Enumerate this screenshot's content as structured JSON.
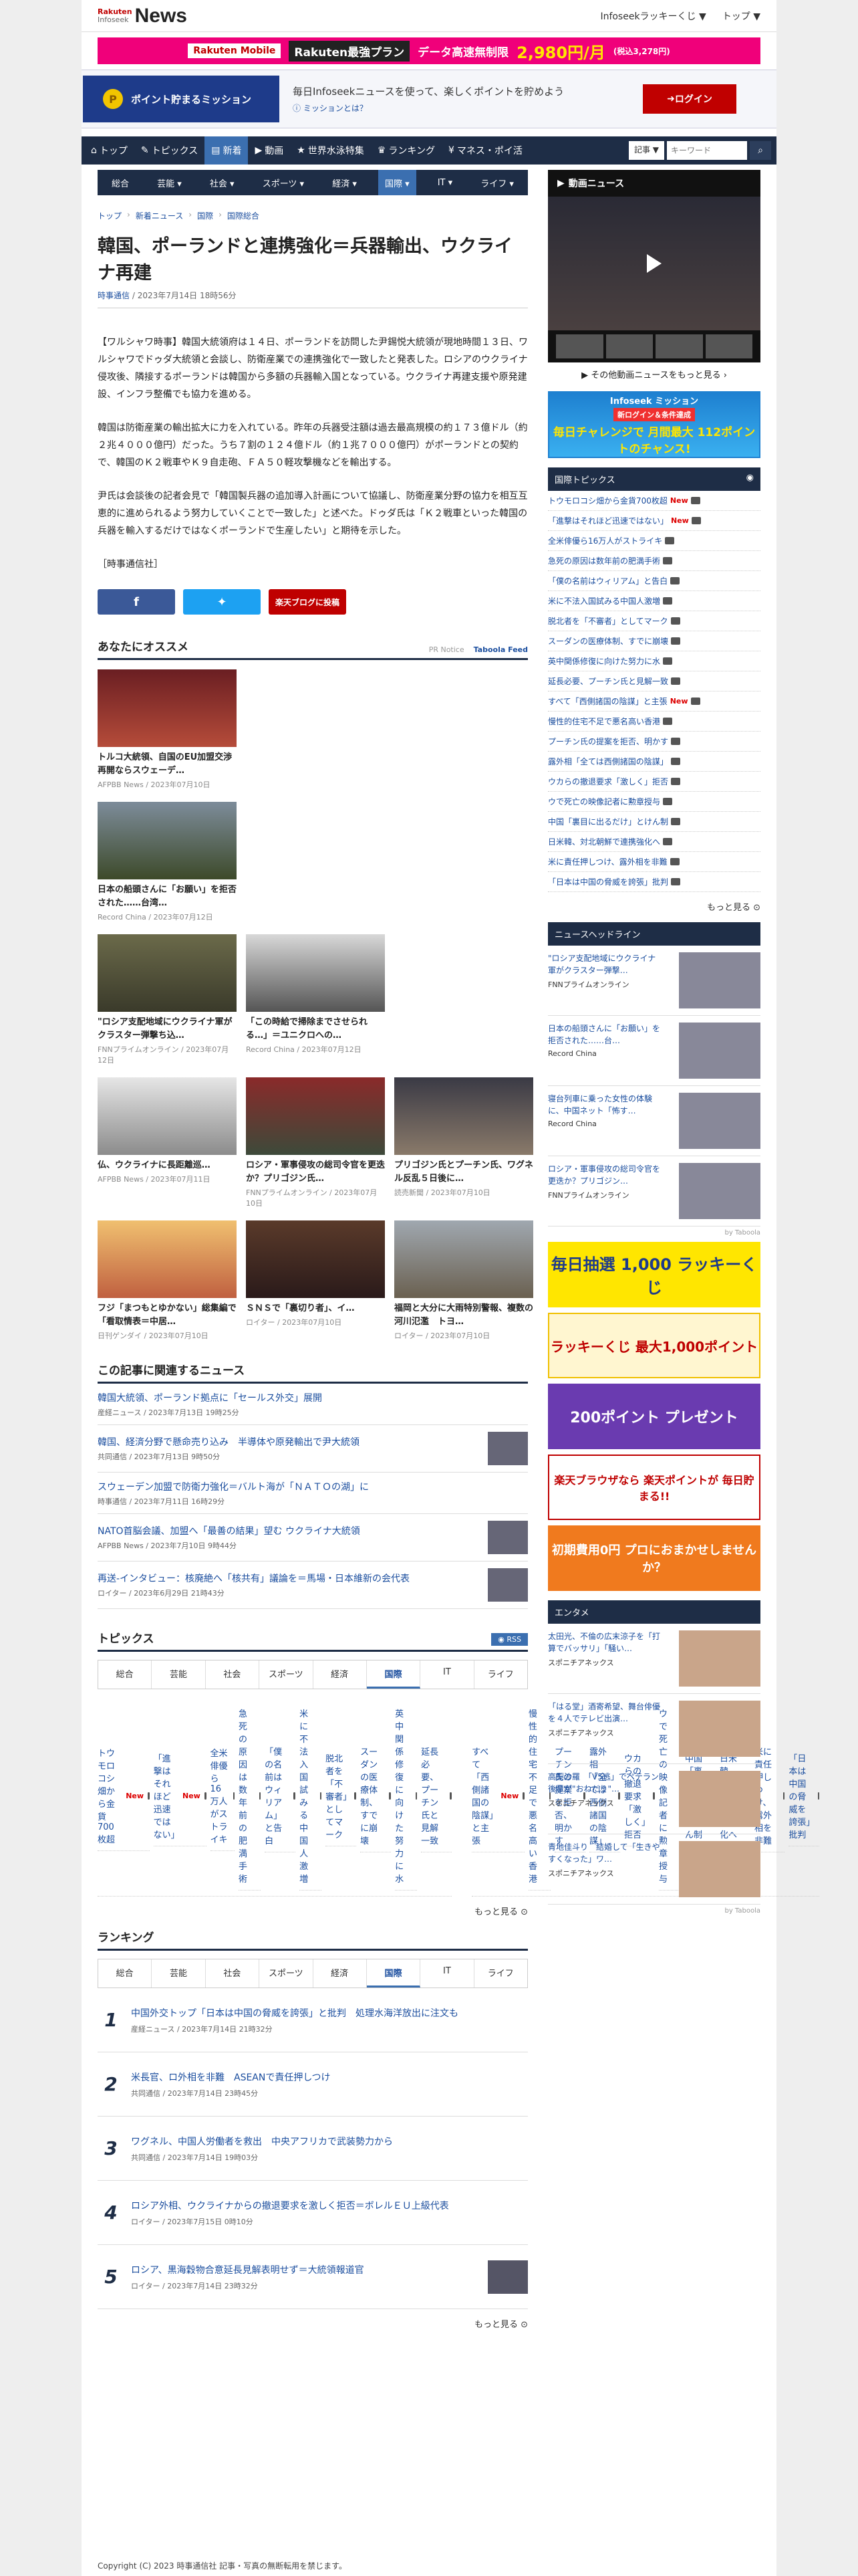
{
  "header": {
    "brand_top": "Rakuten",
    "brand_sub": "Infoseek",
    "brand_news": "News",
    "links": [
      "Infoseekラッキーくじ ▼",
      "トップ ▼"
    ]
  },
  "banner": {
    "b1": "Rakuten Mobile",
    "b2": "Rakuten最強プラン",
    "b3": "データ高速無制限",
    "price": "2,980円/月",
    "price_small": "(税込3,278円)"
  },
  "mission": {
    "title": "ポイント貯まるミッション",
    "text": "毎日Infoseekニュースを使って、楽しくポイントを貯めよう",
    "link": "ミッションとは？",
    "login": "ログイン"
  },
  "nav": {
    "items": [
      "トップ",
      "トピックス",
      "新着",
      "動画",
      "世界水泳特集",
      "ランキング",
      "マネス・ポイ活"
    ],
    "search_select": "記事 ▼",
    "search_placeholder": "キーワード"
  },
  "subnav": [
    "総合",
    "芸能 ▾",
    "社会 ▾",
    "スポーツ ▾",
    "経済 ▾",
    "国際 ▾",
    "IT ▾",
    "ライフ ▾"
  ],
  "breadcrumb": [
    "トップ",
    "新着ニュース",
    "国際",
    "国際総合"
  ],
  "article": {
    "title": "韓国、ポーランドと連携強化＝兵器輸出、ウクライナ再建",
    "source": "時事通信",
    "date": " / 2023年7月14日 18時56分",
    "p1": "【ワルシャワ時事】韓国大統領府は１４日、ポーランドを訪問した尹錫悦大統領が現地時間１３日、ワルシャワでドゥダ大統領と会談し、防衛産業での連携強化で一致したと発表した。ロシアのウクライナ侵攻後、隣接するポーランドは韓国から多額の兵器輸入国となっている。ウクライナ再建支援や原発建設、インフラ整備でも協力を進める。",
    "p2": "韓国は防衛産業の輸出拡大に力を入れている。昨年の兵器受注額は過去最高規模の約１７３億ドル（約２兆４０００億円）だった。うち７割の１２４億ドル（約１兆７０００億円）がポーランドとの契約で、韓国のＫ２戦車やＫ９自走砲、ＦＡ５０軽攻撃機などを輸出する。",
    "p3": "尹氏は会談後の記者会見で「韓国製兵器の追加導入計画について協議し、防衛産業分野の協力を相互互恵的に進められるよう努力していくことで一致した」と述べた。ドゥダ氏は「Ｋ２戦車といった韓国の兵器を輸入するだけではなくポーランドで生産したい」と期待を示した。",
    "p4": "［時事通信社］"
  },
  "share": {
    "rakuten": "楽天ブログに投稿",
    "jiji": "JIJI PRESS",
    "jiji_sub": "時事通信社"
  },
  "recommend": {
    "title": "あなたにオススメ",
    "credit": "PR Notice",
    "provider": "Taboola Feed",
    "items": [
      {
        "title": "トルコ大統領、自国のEU加盟交渉再開ならスウェーデ…",
        "src": "AFPBB News / 2023年07月10日"
      },
      {
        "title": "日本の船頭さんに「お願い」を拒否された……台湾…",
        "src": "Record China / 2023年07月12日"
      },
      {
        "title": "\"ロシア支配地域にウクライナ軍がクラスター弾撃ち込…",
        "src": "FNNプライムオンライン / 2023年07月12日"
      },
      {
        "title": "「この時給で掃除までさせられる…」＝ユニクロへの…",
        "src": "Record China / 2023年07月12日"
      },
      {
        "title": "仏、ウクライナに長距離巡…",
        "src": "AFPBB News / 2023年07月11日"
      },
      {
        "title": "ロシア・軍事侵攻の総司令官を更迭か？プリゴジン氏…",
        "src": "FNNプライムオンライン / 2023年07月10日"
      },
      {
        "title": "プリゴジン氏とプーチン氏、ワグネル反乱５日後に…",
        "src": "読売新聞 / 2023年07月10日"
      },
      {
        "title": "フジ「まつもとゆかない」総集編で「看取情表＝中居…",
        "src": "日刊ゲンダイ / 2023年07月10日"
      },
      {
        "title": "ＳＮＳで「裏切り者」、イ…",
        "src": "ロイター / 2023年07月10日"
      },
      {
        "title": "福岡と大分に大雨特別警報、複数の河川氾濫　トヨ…",
        "src": "ロイター / 2023年07月10日"
      }
    ]
  },
  "related": {
    "title": "この記事に関連するニュース",
    "items": [
      {
        "title": "韓国大統領、ポーランド拠点に「セールス外交」展開",
        "src": "産経ニュース / 2023年7月13日 19時25分"
      },
      {
        "title": "韓国、経済分野で懸命売り込み　半導体や原発輸出で尹大統領",
        "src": "共同通信 / 2023年7月13日 9時50分"
      },
      {
        "title": "スウェーデン加盟で防衛力強化＝バルト海が「ＮＡＴＯの湖」に",
        "src": "時事通信 / 2023年7月11日 16時29分"
      },
      {
        "title": "NATO首脳会議、加盟へ「最善の結果」望む ウクライナ大統領",
        "src": "AFPBB News / 2023年7月10日 9時44分"
      },
      {
        "title": "再送-インタビュー：核廃絶へ「核共有」議論を＝馬場・日本維新の会代表",
        "src": "ロイター / 2023年6月29日 21時43分"
      }
    ]
  },
  "topics": {
    "title": "トピックス",
    "rss": "RSS",
    "tabs": [
      "総合",
      "芸能",
      "社会",
      "スポーツ",
      "経済",
      "国際",
      "IT",
      "ライフ"
    ],
    "left": [
      "トウモロコシ畑から金貨700枚超",
      "「進撃はそれほど迅速ではない」",
      "全米俳優ら16万人がストライキ",
      "急死の原因は数年前の肥満手術",
      "「僕の名前はウィリアム」と告白",
      "米に不法入国試みる中国人激増",
      "脱北者を「不審者」としてマーク",
      "スーダンの医療体制、すでに崩壊",
      "英中関係修復に向けた努力に水",
      "延長必要、プーチン氏と見解一致"
    ],
    "right": [
      "すべて「西側諸国の陰謀」と主張",
      "慢性的住宅不足で悪名高い香港",
      "プーチン氏の提案を拒否、明かす",
      "露外相「全ては西側諸国の陰謀」",
      "ウカらの撤退要求「激しく」拒否",
      "ウで死亡の映像記者に勲章授与",
      "中国「裏目に出るだけ」とけん制",
      "日米韓、対北朝鮮で連携強化へ",
      "米に責任押しつけ、露外相を非難",
      "「日本は中国の脅威を誇張」批判"
    ],
    "new_marks": [
      0,
      1
    ],
    "more": "もっと見る"
  },
  "ranking": {
    "title": "ランキング",
    "tabs": [
      "総合",
      "芸能",
      "社会",
      "スポーツ",
      "経済",
      "国際",
      "IT",
      "ライフ"
    ],
    "items": [
      {
        "no": "1",
        "title": "中国外交トップ「日本は中国の脅威を誇張」と批判　処理水海洋放出に注文も",
        "src": "産経ニュース / 2023年7月14日 21時32分"
      },
      {
        "no": "2",
        "title": "米長官、ロ外相を非難　ASEANで責任押しつけ",
        "src": "共同通信 / 2023年7月14日 23時45分"
      },
      {
        "no": "3",
        "title": "ワグネル、中国人労働者を救出　中央アフリカで武装勢力から",
        "src": "共同通信 / 2023年7月14日 19時03分"
      },
      {
        "no": "4",
        "title": "ロシア外相、ウクライナからの撤退要求を激しく拒否＝ボレルＥＵ上級代表",
        "src": "ロイター / 2023年7月15日 0時10分"
      },
      {
        "no": "5",
        "title": "ロシア、黒海穀物合意延長見解表明せず＝大統領報道官",
        "src": "ロイター / 2023年7月14日 23時32分"
      }
    ],
    "more": "もっと見る"
  },
  "side": {
    "video_title": "動画ニュース",
    "video_more": "その他動画ニュースをもっと見る",
    "ad1_title": "Infoseek ミッション",
    "ad1_sub": "新ログイン＆条件達成",
    "ad1_text": "毎日チャレンジで 月間最大 112ポイントのチャンス!",
    "intl_title": "国際トピックス",
    "intl_list": [
      "トウモロコシ畑から金貨700枚超",
      "「進撃はそれほど迅速ではない」",
      "全米俳優ら16万人がストライキ",
      "急死の原因は数年前の肥満手術",
      "「僕の名前はウィリアム」と告白",
      "米に不法入国試みる中国人激増",
      "脱北者を「不審者」としてマーク",
      "スーダンの医療体制、すでに崩壊",
      "英中関係修復に向けた努力に水",
      "延長必要、プーチン氏と見解一致",
      "すべて「西側諸国の陰謀」と主張",
      "慢性的住宅不足で悪名高い香港",
      "プーチン氏の提案を拒否、明かす",
      "露外相「全ては西側諸国の陰謀」",
      "ウカらの撤退要求「激しく」拒否",
      "ウで死亡の映像記者に勲章授与",
      "中国「裏目に出るだけ」とけん制",
      "日米韓、対北朝鮮で連携強化へ",
      "米に責任押しつけ、露外相を非難",
      "「日本は中国の脅威を誇張」批判"
    ],
    "intl_more": "もっと見る",
    "headline_title": "ニュースヘッドライン",
    "headlines": [
      {
        "t": "\"ロシア支配地域にウクライナ軍がクラスター弾撃…",
        "s": "FNNプライムオンライン"
      },
      {
        "t": "日本の船頭さんに「お願い」を拒否された……台…",
        "s": "Record China"
      },
      {
        "t": "寝台列車に乗った女性の体験に、中国ネット「怖す…",
        "s": "Record China"
      },
      {
        "t": "ロシア・軍事侵攻の総司令官を更迭か？プリゴジン…",
        "s": "FNNプライムオンライン"
      }
    ],
    "taboola": "by Taboola",
    "ad_lucky": "毎日抽選 1,000 ラッキーくじ",
    "ad_lucky2": "ラッキーくじ 最大1,000ポイント",
    "ad_viber": "200ポイント プレゼント",
    "ad_point": "楽天ブラウザなら 楽天ポイントが 毎日貯まる!!",
    "ad_zero": "初期費用0円 プロにおまかせしませんか？",
    "ent_title": "エンタメ",
    "ent": [
      {
        "t": "太田光、不倫の広末涼子を「打算でバッサリ」「騒い…",
        "s": "スポニチアネックス"
      },
      {
        "t": "「はる堂」酒寄希望、舞台俳優を４人でテレビ出演…",
        "s": "スポニチアネックス"
      },
      {
        "t": "高梨沙羅　「V5逃」でペテラン後輩が\"おねだり\"…",
        "s": "スポニチアネックス"
      },
      {
        "t": "青地佳斗り　結婚して「生きやすくなった」ワ…",
        "s": "スポニチアネックス"
      }
    ]
  },
  "footer": "Copyright (C) 2023 時事通信社 記事・写真の無断転用を禁じます。"
}
